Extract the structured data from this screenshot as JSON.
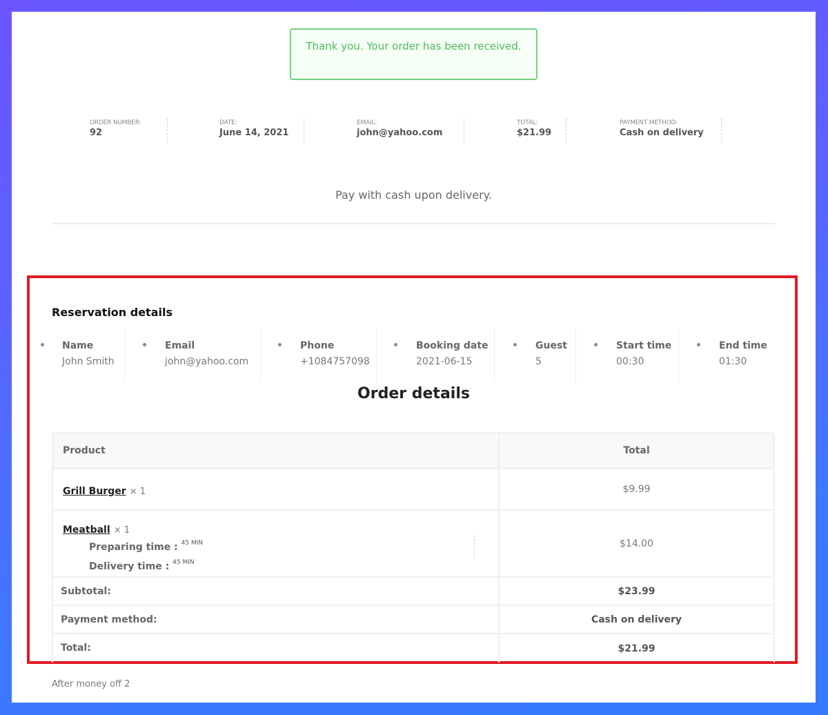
{
  "notice": {
    "message": "Thank you. Your order has been received."
  },
  "overview": [
    {
      "label": "Order number:",
      "value": "92"
    },
    {
      "label": "Date:",
      "value": "June 14, 2021"
    },
    {
      "label": "Email:",
      "value": "john@yahoo.com"
    },
    {
      "label": "Total:",
      "value": "$21.99"
    },
    {
      "label": "Payment method:",
      "value": "Cash on delivery"
    }
  ],
  "payment_note": "Pay with cash upon delivery.",
  "reservation": {
    "title": "Reservation details",
    "fields": [
      {
        "label": "Name",
        "value": "John Smith"
      },
      {
        "label": "Email",
        "value": "john@yahoo.com"
      },
      {
        "label": "Phone",
        "value": "+1084757098"
      },
      {
        "label": "Booking date",
        "value": "2021-06-15"
      },
      {
        "label": "Guest",
        "value": "5"
      },
      {
        "label": "Start time",
        "value": "00:30"
      },
      {
        "label": "End time",
        "value": "01:30"
      }
    ]
  },
  "order": {
    "title": "Order details",
    "columns": {
      "product": "Product",
      "total": "Total"
    },
    "items": [
      {
        "name": "Grill Burger",
        "qty": "× 1",
        "total": "$9.99"
      },
      {
        "name": "Meatball",
        "qty": "× 1",
        "total": "$14.00",
        "meta": [
          {
            "label": "Preparing time :",
            "value": "45 MIN"
          },
          {
            "label": "Delivery time :",
            "value": "45 MIN"
          }
        ]
      }
    ],
    "totals": [
      {
        "label": "Subtotal:",
        "value": "$23.99"
      },
      {
        "label": "Payment method:",
        "value": "Cash on delivery"
      },
      {
        "label": "Total:",
        "value": "$21.99"
      }
    ]
  },
  "after_note": "After money off 2",
  "colors": {
    "notice_border": "#6fd27f",
    "notice_text": "#4fb85a",
    "highlight_border": "#e11a25",
    "background_top": "#6a55ff",
    "background_bottom": "#3479ff"
  }
}
